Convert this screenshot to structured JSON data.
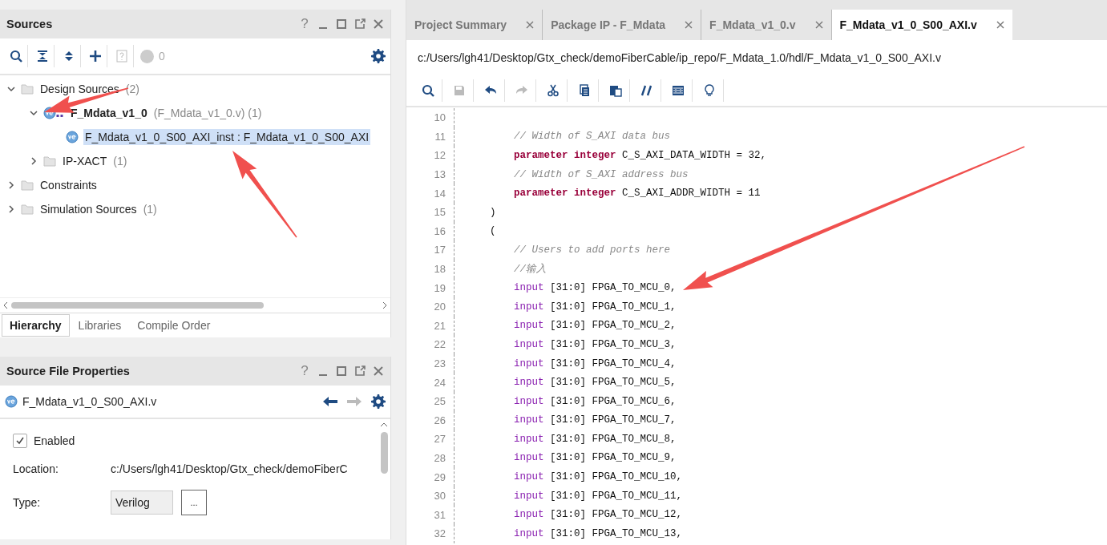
{
  "sources": {
    "title": "Sources",
    "help": "?",
    "toolbar": [
      {
        "kind": "search",
        "disabled": false
      },
      {
        "kind": "collapse-all",
        "disabled": false
      },
      {
        "kind": "expand-all",
        "disabled": false
      },
      {
        "kind": "add",
        "disabled": false
      },
      {
        "kind": "help",
        "disabled": true
      }
    ],
    "message_count": "0",
    "tree": [
      {
        "label": "Design Sources",
        "detail": "(2)",
        "kind": "folder",
        "expanded": true,
        "selected": false,
        "children": [
          {
            "label": "F_Mdata_v1_0",
            "detail": "(F_Mdata_v1_0.v) (1)",
            "kind": "top-module",
            "top": true,
            "expanded": true,
            "selected": false,
            "children": [
              {
                "label": "F_Mdata_v1_0_S00_AXI_inst : F_Mdata_v1_0_S00_AXI",
                "kind": "verilog",
                "selected": true
              }
            ]
          },
          {
            "label": "IP-XACT",
            "detail": "(1)",
            "kind": "folder",
            "expanded": false,
            "selected": false
          }
        ]
      },
      {
        "label": "Constraints",
        "kind": "folder",
        "expanded": false,
        "selected": false
      },
      {
        "label": "Simulation Sources",
        "detail": "(1)",
        "kind": "folder",
        "expanded": false,
        "selected": false
      }
    ],
    "tabs": [
      {
        "label": "Hierarchy",
        "selected": true
      },
      {
        "label": "Libraries",
        "selected": false
      },
      {
        "label": "Compile Order",
        "selected": false
      }
    ]
  },
  "properties": {
    "title": "Source File Properties",
    "help": "?",
    "file": "F_Mdata_v1_0_S00_AXI.v",
    "enabled": {
      "label": "Enabled",
      "checked": true
    },
    "location": {
      "label": "Location:",
      "value": "c:/Users/lgh41/Desktop/Gtx_check/demoFiberC"
    },
    "type": {
      "label": "Type:",
      "value": "Verilog",
      "browse": "..."
    }
  },
  "editor": {
    "tabs": [
      {
        "label": "Project Summary",
        "selected": false
      },
      {
        "label": "Package IP - F_Mdata",
        "selected": false
      },
      {
        "label": "F_Mdata_v1_0.v",
        "selected": false
      },
      {
        "label": "F_Mdata_v1_0_S00_AXI.v",
        "selected": true
      }
    ],
    "path": "c:/Users/lgh41/Desktop/Gtx_check/demoFiberCable/ip_repo/F_Mdata_1.0/hdl/F_Mdata_v1_0_S00_AXI.v",
    "toolbar": [
      {
        "kind": "search",
        "disabled": false
      },
      {
        "kind": "save",
        "disabled": true
      },
      {
        "kind": "undo",
        "disabled": false
      },
      {
        "kind": "redo",
        "disabled": true
      },
      {
        "kind": "cut",
        "disabled": false
      },
      {
        "kind": "copy",
        "disabled": false
      },
      {
        "kind": "paste",
        "disabled": false
      },
      {
        "kind": "comment",
        "disabled": false
      },
      {
        "kind": "columns",
        "disabled": false
      },
      {
        "kind": "bulb",
        "disabled": false
      }
    ],
    "lines": [
      {
        "number": "10"
      },
      {
        "number": "11",
        "tokens": [
          {
            "kind": "comment",
            "text": "        // Width of S_AXI data bus"
          }
        ]
      },
      {
        "number": "12",
        "tokens": [
          {
            "kind": "keyword",
            "text": "        parameter integer"
          },
          {
            "kind": "plain",
            "text": " C_S_AXI_DATA_WIDTH = 32,"
          }
        ]
      },
      {
        "number": "13",
        "tokens": [
          {
            "kind": "comment",
            "text": "        // Width of S_AXI address bus"
          }
        ]
      },
      {
        "number": "14",
        "tokens": [
          {
            "kind": "keyword",
            "text": "        parameter integer"
          },
          {
            "kind": "plain",
            "text": " C_S_AXI_ADDR_WIDTH = 11"
          }
        ]
      },
      {
        "number": "15",
        "tokens": [
          {
            "kind": "plain",
            "text": "    )"
          }
        ]
      },
      {
        "number": "16",
        "tokens": [
          {
            "kind": "plain",
            "text": "    ("
          }
        ]
      },
      {
        "number": "17",
        "tokens": [
          {
            "kind": "comment",
            "text": "        // Users to add ports here"
          }
        ]
      },
      {
        "number": "18",
        "tokens": [
          {
            "kind": "comment",
            "text": "        //输入"
          }
        ]
      },
      {
        "number": "19",
        "tokens": [
          {
            "kind": "port",
            "text": "        input"
          },
          {
            "kind": "plain",
            "text": " [31:0] FPGA_TO_MCU_0,"
          }
        ]
      },
      {
        "number": "20",
        "tokens": [
          {
            "kind": "port",
            "text": "        input"
          },
          {
            "kind": "plain",
            "text": " [31:0] FPGA_TO_MCU_1,"
          }
        ]
      },
      {
        "number": "21",
        "tokens": [
          {
            "kind": "port",
            "text": "        input"
          },
          {
            "kind": "plain",
            "text": " [31:0] FPGA_TO_MCU_2,"
          }
        ]
      },
      {
        "number": "22",
        "tokens": [
          {
            "kind": "port",
            "text": "        input"
          },
          {
            "kind": "plain",
            "text": " [31:0] FPGA_TO_MCU_3,"
          }
        ]
      },
      {
        "number": "23",
        "tokens": [
          {
            "kind": "port",
            "text": "        input"
          },
          {
            "kind": "plain",
            "text": " [31:0] FPGA_TO_MCU_4,"
          }
        ]
      },
      {
        "number": "24",
        "tokens": [
          {
            "kind": "port",
            "text": "        input"
          },
          {
            "kind": "plain",
            "text": " [31:0] FPGA_TO_MCU_5,"
          }
        ]
      },
      {
        "number": "25",
        "tokens": [
          {
            "kind": "port",
            "text": "        input"
          },
          {
            "kind": "plain",
            "text": " [31:0] FPGA_TO_MCU_6,"
          }
        ]
      },
      {
        "number": "26",
        "tokens": [
          {
            "kind": "port",
            "text": "        input"
          },
          {
            "kind": "plain",
            "text": " [31:0] FPGA_TO_MCU_7,"
          }
        ]
      },
      {
        "number": "27",
        "tokens": [
          {
            "kind": "port",
            "text": "        input"
          },
          {
            "kind": "plain",
            "text": " [31:0] FPGA_TO_MCU_8,"
          }
        ]
      },
      {
        "number": "28",
        "tokens": [
          {
            "kind": "port",
            "text": "        input"
          },
          {
            "kind": "plain",
            "text": " [31:0] FPGA_TO_MCU_9,"
          }
        ]
      },
      {
        "number": "29",
        "tokens": [
          {
            "kind": "port",
            "text": "        input"
          },
          {
            "kind": "plain",
            "text": " [31:0] FPGA_TO_MCU_10,"
          }
        ]
      },
      {
        "number": "30",
        "tokens": [
          {
            "kind": "port",
            "text": "        input"
          },
          {
            "kind": "plain",
            "text": " [31:0] FPGA_TO_MCU_11,"
          }
        ]
      },
      {
        "number": "31",
        "tokens": [
          {
            "kind": "port",
            "text": "        input"
          },
          {
            "kind": "plain",
            "text": " [31:0] FPGA_TO_MCU_12,"
          }
        ]
      },
      {
        "number": "32",
        "tokens": [
          {
            "kind": "port",
            "text": "        input"
          },
          {
            "kind": "plain",
            "text": " [31:0] FPGA_TO_MCU_13,"
          }
        ]
      }
    ]
  }
}
